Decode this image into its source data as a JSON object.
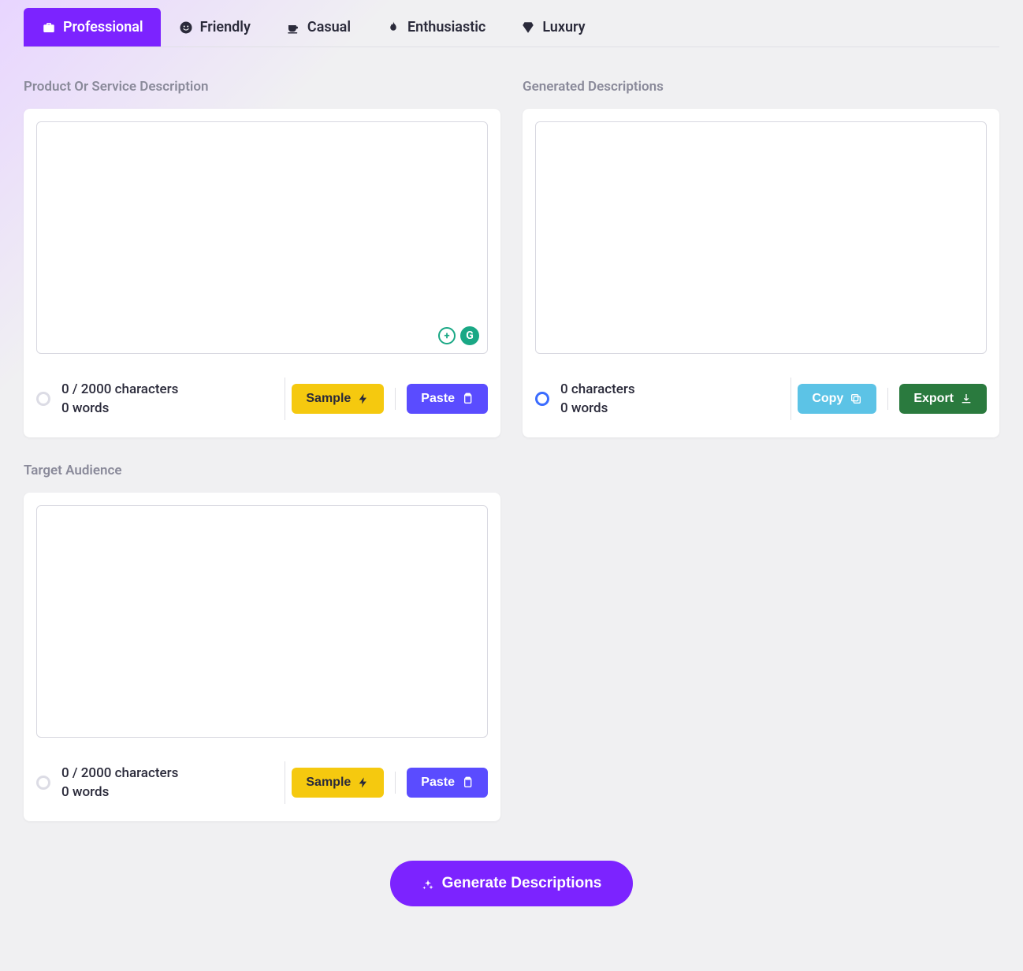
{
  "tabs": [
    {
      "label": "Professional",
      "icon": "briefcase",
      "active": true
    },
    {
      "label": "Friendly",
      "icon": "smile",
      "active": false
    },
    {
      "label": "Casual",
      "icon": "coffee",
      "active": false
    },
    {
      "label": "Enthusiastic",
      "icon": "fire",
      "active": false
    },
    {
      "label": "Luxury",
      "icon": "gem",
      "active": false
    }
  ],
  "sections": {
    "product": {
      "title": "Product Or Service Description",
      "char_count": "0 / 2000 characters",
      "word_count": "0 words",
      "sample_label": "Sample",
      "paste_label": "Paste"
    },
    "audience": {
      "title": "Target Audience",
      "char_count": "0 / 2000 characters",
      "word_count": "0 words",
      "sample_label": "Sample",
      "paste_label": "Paste"
    },
    "generated": {
      "title": "Generated Descriptions",
      "char_count": "0 characters",
      "word_count": "0 words",
      "copy_label": "Copy",
      "export_label": "Export"
    }
  },
  "generate_button": "Generate Descriptions",
  "colors": {
    "accent": "#7c23ff",
    "sample": "#f5c90f",
    "paste": "#5a4cff",
    "copy": "#5cc3e6",
    "export": "#2a7a3e"
  },
  "grammarly": {
    "plus": "+",
    "g": "G"
  }
}
